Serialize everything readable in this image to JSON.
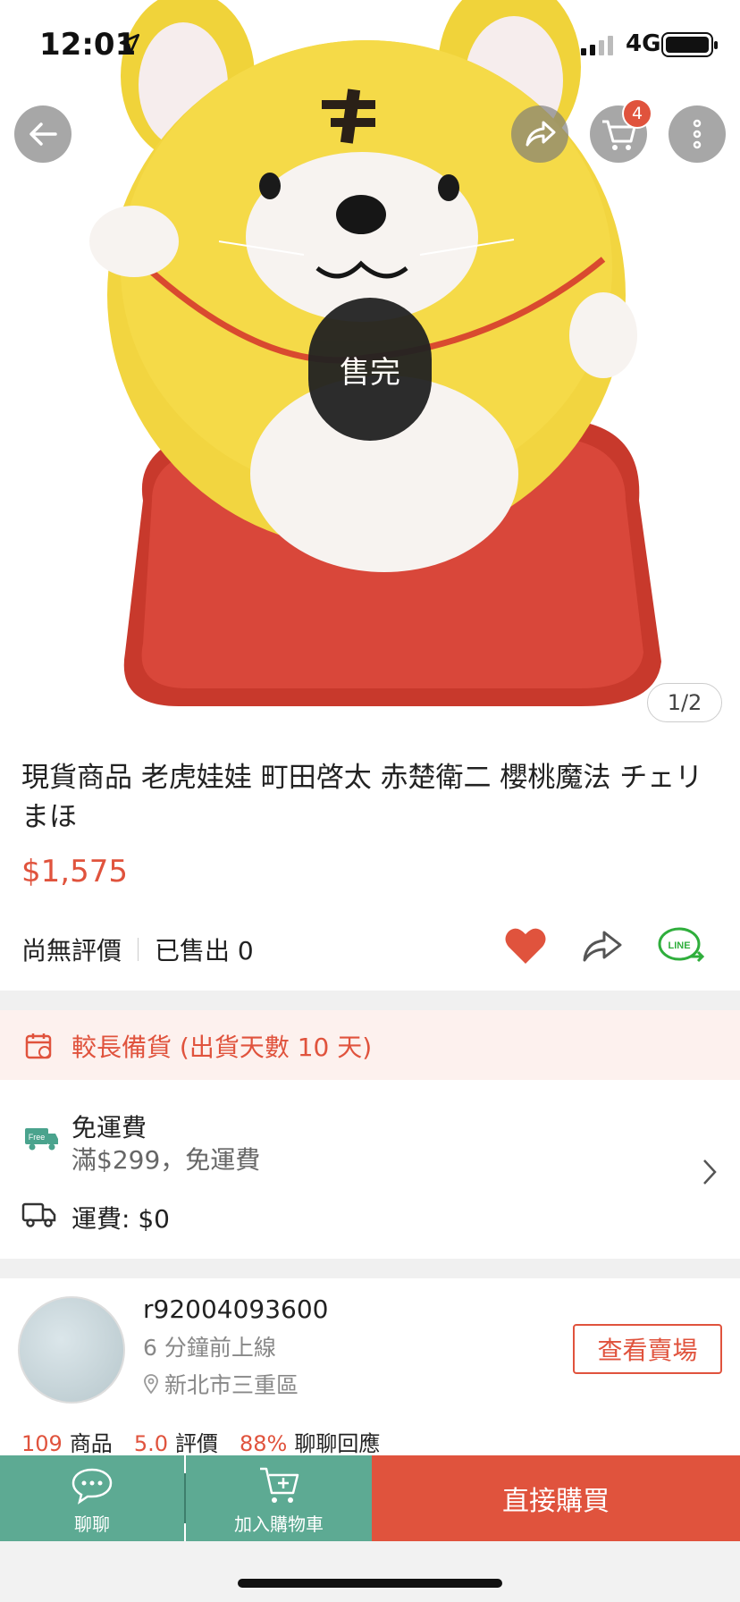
{
  "status_bar": {
    "time": "12:01",
    "network": "4G"
  },
  "header": {
    "cart_count": "4",
    "sold_out_label": "售完",
    "image_pager": "1/2"
  },
  "product": {
    "title": "現貨商品 老虎娃娃 町田啓太 赤楚衛二 櫻桃魔法 チェリまほ",
    "price": "$1,575",
    "rating_text": "尚無評價",
    "sold_text": "已售出 0"
  },
  "notice": {
    "text": "較長備貨 (出貨天數 10 天)"
  },
  "shipping": {
    "free_badge": "Free",
    "title": "免運費",
    "subtitle": "滿$299，免運費",
    "fee": "運費: $0"
  },
  "seller": {
    "name": "r92004093600",
    "online": "6 分鐘前上線",
    "location": "新北市三重區",
    "view_button": "查看賣場",
    "stats": [
      {
        "num": "109",
        "label": "商品"
      },
      {
        "num": "5.0",
        "label": "評價"
      },
      {
        "num": "88%",
        "label": "聊聊回應"
      }
    ]
  },
  "bottom_bar": {
    "chat": "聊聊",
    "add_cart": "加入購物車",
    "buy": "直接購買"
  },
  "colors": {
    "accent": "#e0533d",
    "green": "#5daa93",
    "notice_bg": "#fdf1ee"
  },
  "icons": [
    "back-icon",
    "share-icon",
    "cart-icon",
    "more-icon",
    "heart-icon",
    "share-outline-icon",
    "line-share-icon",
    "calendar-icon",
    "free-truck-icon",
    "truck-icon",
    "chevron-right-icon",
    "location-pin-icon",
    "chat-icon",
    "add-cart-icon"
  ]
}
